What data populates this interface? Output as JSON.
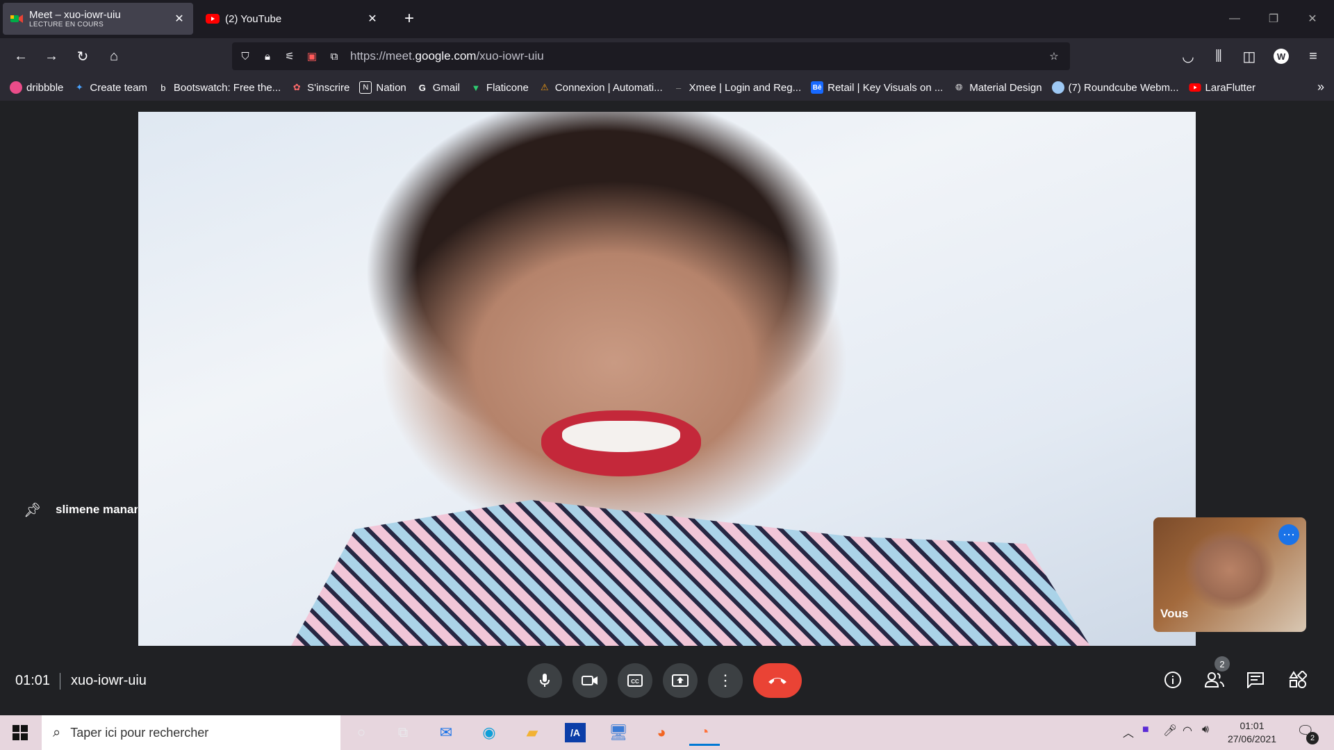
{
  "browser": {
    "tabs": [
      {
        "title": "Meet – xuo-iowr-uiu",
        "subtitle": "LECTURE EN COURS",
        "icon": "meet-icon"
      },
      {
        "title": "(2) YouTube",
        "icon": "youtube-icon"
      }
    ],
    "url_prefix": "https://meet.",
    "url_domain": "google.com",
    "url_path": "/xuo-iowr-uiu",
    "bookmarks": [
      {
        "label": "dribbble",
        "icon": "dribbble-icon",
        "color": "#ea4c89"
      },
      {
        "label": "Create team",
        "icon": "star-icon",
        "color": "#4aa3ff"
      },
      {
        "label": "Bootswatch: Free the...",
        "icon": "bootswatch-icon",
        "color": "#ffffff"
      },
      {
        "label": "S'inscrire",
        "icon": "gear-icon",
        "color": "#ff6b6b"
      },
      {
        "label": "Nation",
        "icon": "notion-icon",
        "color": "#ffffff"
      },
      {
        "label": "Gmail",
        "icon": "google-icon",
        "color": "#ffffff"
      },
      {
        "label": "Flaticone",
        "icon": "flaticon-icon",
        "color": "#2ecc71"
      },
      {
        "label": "Connexion | Automati...",
        "icon": "triangle-icon",
        "color": "#f39c12"
      },
      {
        "label": "Xmee | Login and Reg...",
        "icon": "dash-icon",
        "color": "#888888"
      },
      {
        "label": "Retail | Key Visuals on ...",
        "icon": "behance-icon",
        "color": "#1769ff"
      },
      {
        "label": "Material Design",
        "icon": "globe-icon",
        "color": "#ffffff"
      },
      {
        "label": "(7) Roundcube Webm...",
        "icon": "roundcube-icon",
        "color": "#9ec9f5"
      },
      {
        "label": "LaraFlutter",
        "icon": "youtube-icon",
        "color": "#ff0000"
      }
    ]
  },
  "meet": {
    "speaker_name": "slimene manar",
    "self_label": "Vous",
    "time": "01:01",
    "meeting_code": "xuo-iowr-uiu",
    "participants_count": "2",
    "accent": "#1a73e8",
    "hangup_color": "#ea4335"
  },
  "taskbar": {
    "search_placeholder": "Taper ici pour rechercher",
    "clock_time": "01:01",
    "clock_date": "27/06/2021",
    "notifications_count": "2"
  }
}
